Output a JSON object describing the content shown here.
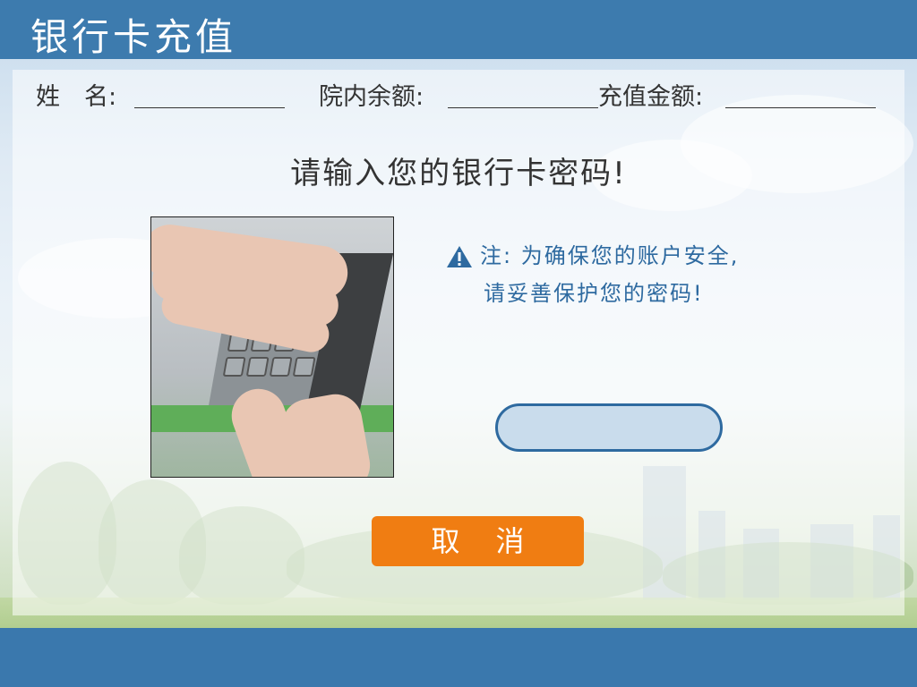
{
  "header": {
    "title": "银行卡充值"
  },
  "fields": {
    "name_label": "姓　名:",
    "balance_label": "院内余额:",
    "recharge_label": "充值金额:"
  },
  "prompt": "请输入您的银行卡密码!",
  "notice": {
    "line1": "注: 为确保您的账户安全,",
    "line2": "请妥善保护您的密码!"
  },
  "password_input": {
    "value": ""
  },
  "cancel_button": {
    "label": "取消"
  },
  "colors": {
    "header_bg": "#3d7bae",
    "accent_blue": "#2e6aa0",
    "cancel_orange": "#f07d12",
    "input_fill": "#c9dcec"
  },
  "icons": {
    "warning": "warning-triangle-icon"
  }
}
